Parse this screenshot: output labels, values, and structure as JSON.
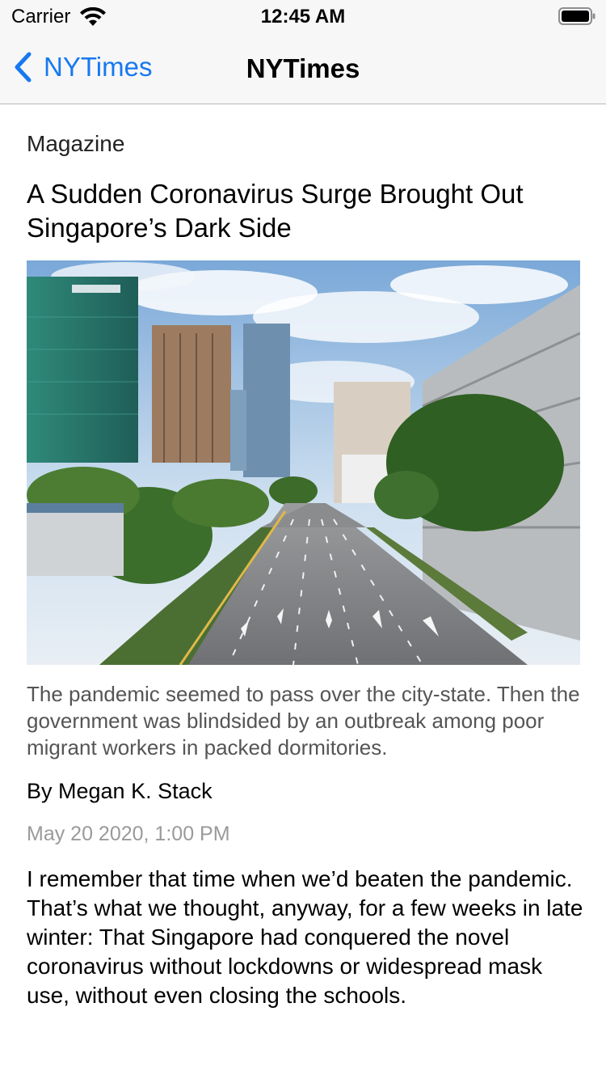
{
  "status_bar": {
    "carrier": "Carrier",
    "time": "12:45 AM"
  },
  "nav": {
    "back_label": "NYTimes",
    "title": "NYTimes",
    "accent_color": "#1779f0"
  },
  "article": {
    "section": "Magazine",
    "headline": "A Sudden Coronavirus Surge Brought Out Singapore’s Dark Side",
    "image_description_icon": "photo-icon",
    "caption": "The pandemic seemed to pass over the city-state. Then the government was blindsided by an outbreak among poor migrant workers in packed dormitories.",
    "byline": "By Megan K. Stack",
    "date": "May 20 2020, 1:00 PM",
    "body": "I remember that time when we’d beaten the pandemic. That’s what we thought, anyway, for a few weeks in late winter: That Singapore had conquered the novel coronavirus without lockdowns or widespread mask use, without even closing the schools."
  }
}
